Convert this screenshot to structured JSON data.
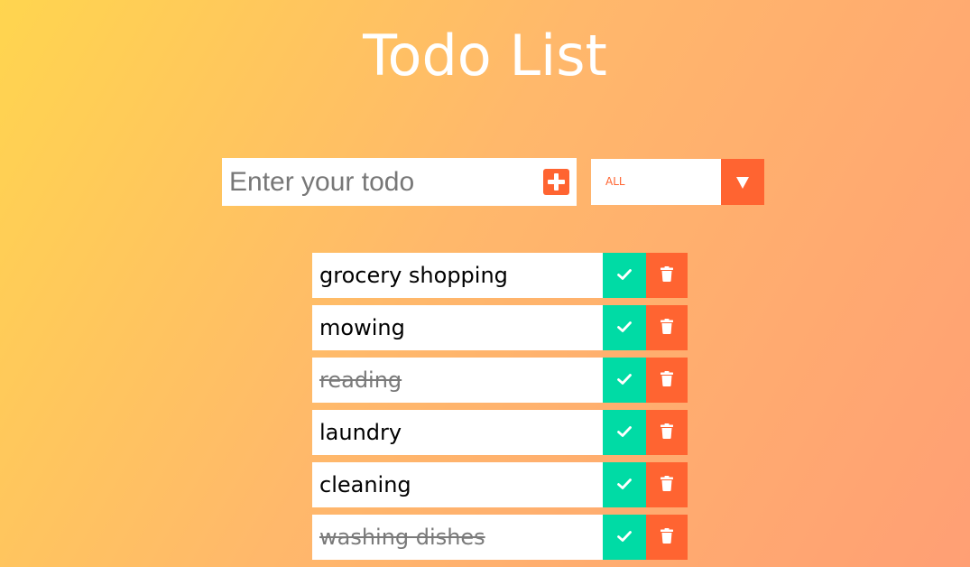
{
  "page": {
    "title": "Todo List"
  },
  "form": {
    "input_placeholder": "Enter your todo",
    "input_value": "",
    "add_icon": "plus-square-icon"
  },
  "filter": {
    "selected": "ALL",
    "arrow_icon": "caret-down-icon"
  },
  "colors": {
    "accent": "#ff6431",
    "complete": "#00dba5",
    "background_start": "#ffd54f",
    "background_end": "#ff9f74"
  },
  "todos": [
    {
      "text": "grocery shopping",
      "completed": false
    },
    {
      "text": "mowing",
      "completed": false
    },
    {
      "text": "reading",
      "completed": true
    },
    {
      "text": "laundry",
      "completed": false
    },
    {
      "text": "cleaning",
      "completed": false
    },
    {
      "text": "washing dishes",
      "completed": true
    }
  ],
  "icons": {
    "complete": "check-icon",
    "delete": "trash-icon"
  }
}
